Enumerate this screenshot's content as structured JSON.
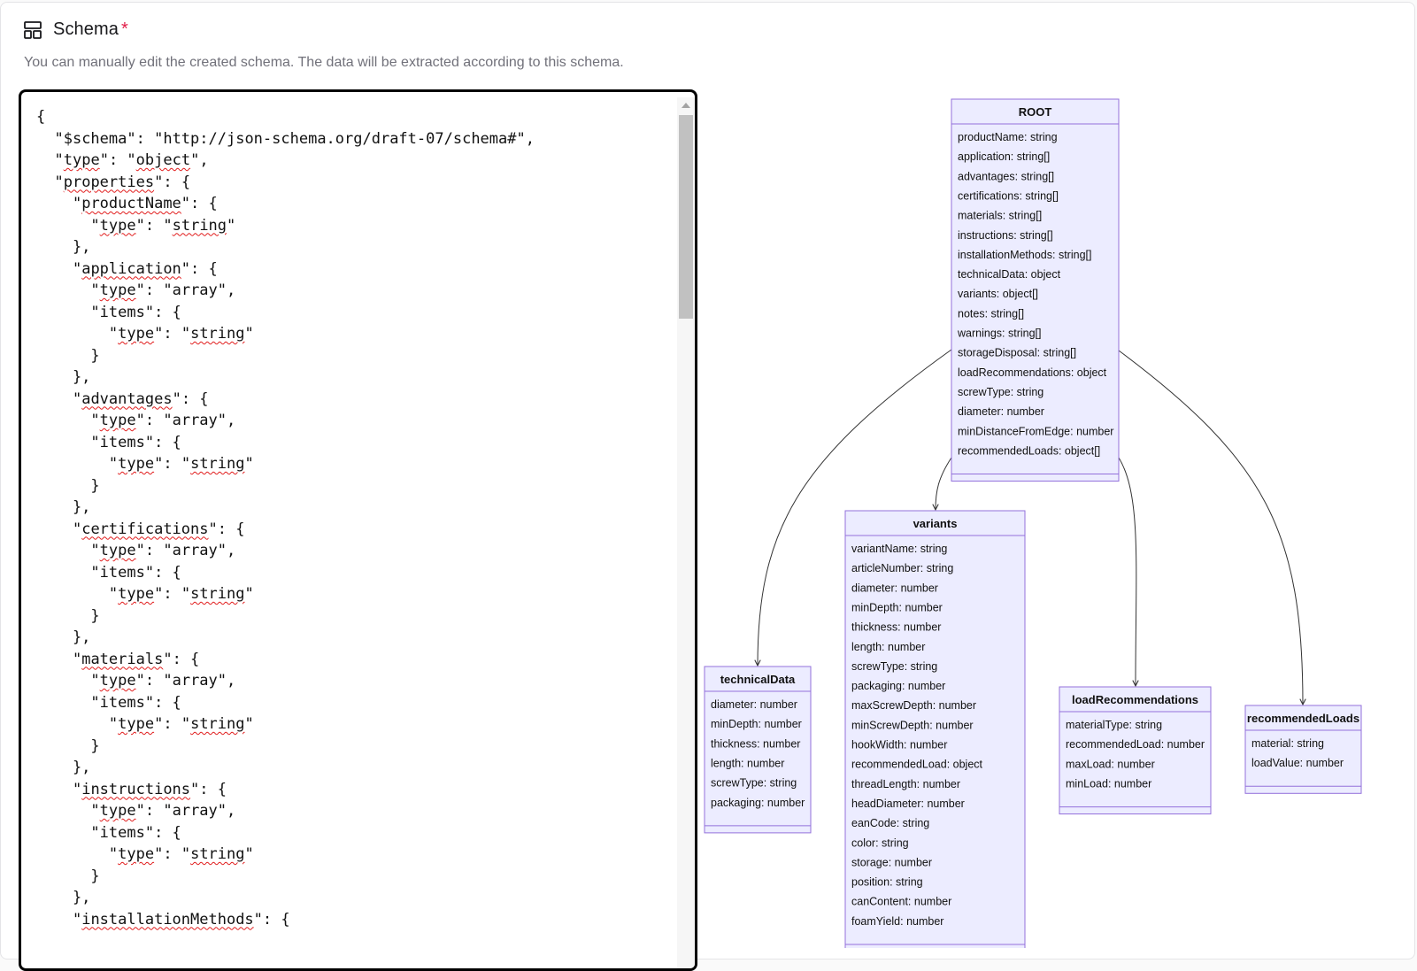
{
  "header": {
    "title": "Schema",
    "required_mark": "*",
    "subtitle": "You can manually edit the created schema. The data will be extracted according to this schema."
  },
  "editor": {
    "lines": [
      "{",
      "  \"$schema\": \"http://json-schema.org/draft-07/schema#\",",
      "  \"type\": \"object\",",
      "  \"properties\": {",
      "    \"productName\": {",
      "      \"type\": \"string\"",
      "    },",
      "    \"application\": {",
      "      \"type\": \"array\",",
      "      \"items\": {",
      "        \"type\": \"string\"",
      "      }",
      "    },",
      "    \"advantages\": {",
      "      \"type\": \"array\",",
      "      \"items\": {",
      "        \"type\": \"string\"",
      "      }",
      "    },",
      "    \"certifications\": {",
      "      \"type\": \"array\",",
      "      \"items\": {",
      "        \"type\": \"string\"",
      "      }",
      "    },",
      "    \"materials\": {",
      "      \"type\": \"array\",",
      "      \"items\": {",
      "        \"type\": \"string\"",
      "      }",
      "    },",
      "    \"instructions\": {",
      "      \"type\": \"array\",",
      "      \"items\": {",
      "        \"type\": \"string\"",
      "      }",
      "    },",
      "    \"installationMethods\": {"
    ],
    "misspelled_words": [
      "type",
      "object",
      "properties",
      "productName",
      "string",
      "application",
      "advantages",
      "certifications",
      "materials",
      "instructions",
      "installationMethods"
    ]
  },
  "diagram": {
    "node_fill": "#ececff",
    "node_stroke": "#9370db",
    "edge_color": "#333333",
    "nodes": [
      {
        "id": "ROOT",
        "title": "ROOT",
        "attributes": [
          "productName: string",
          "application: string[]",
          "advantages: string[]",
          "certifications: string[]",
          "materials: string[]",
          "instructions: string[]",
          "installationMethods: string[]",
          "technicalData: object",
          "variants: object[]",
          "notes: string[]",
          "warnings: string[]",
          "storageDisposal: string[]",
          "loadRecommendations: object",
          "screwType: string",
          "diameter: number",
          "minDistanceFromEdge: number",
          "recommendedLoads: object[]"
        ]
      },
      {
        "id": "variants",
        "title": "variants",
        "attributes": [
          "variantName: string",
          "articleNumber: string",
          "diameter: number",
          "minDepth: number",
          "thickness: number",
          "length: number",
          "screwType: string",
          "packaging: number",
          "maxScrewDepth: number",
          "minScrewDepth: number",
          "hookWidth: number",
          "recommendedLoad: object",
          "threadLength: number",
          "headDiameter: number",
          "eanCode: string",
          "color: string",
          "storage: number",
          "position: string",
          "canContent: number",
          "foamYield: number"
        ]
      },
      {
        "id": "technicalData",
        "title": "technicalData",
        "attributes": [
          "diameter: number",
          "minDepth: number",
          "thickness: number",
          "length: number",
          "screwType: string",
          "packaging: number"
        ]
      },
      {
        "id": "loadRecommendations",
        "title": "loadRecommendations",
        "attributes": [
          "materialType: string",
          "recommendedLoad: number",
          "maxLoad: number",
          "minLoad: number"
        ]
      },
      {
        "id": "recommendedLoads",
        "title": "recommendedLoads",
        "attributes": [
          "material: string",
          "loadValue: number"
        ]
      }
    ],
    "edges": [
      {
        "from": "ROOT",
        "to": "technicalData"
      },
      {
        "from": "ROOT",
        "to": "variants"
      },
      {
        "from": "ROOT",
        "to": "loadRecommendations"
      },
      {
        "from": "ROOT",
        "to": "recommendedLoads"
      }
    ]
  }
}
